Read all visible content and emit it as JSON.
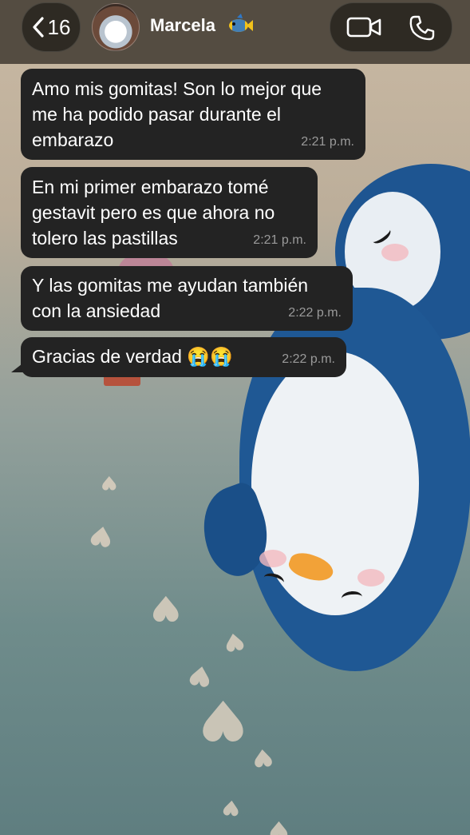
{
  "header": {
    "back_count": "16",
    "contact_name": "Marcela",
    "name_emoji": "fish-icon"
  },
  "messages": [
    {
      "lines": [
        "Amo mis gomitas! Son lo mejor que",
        "me ha podido pasar durante el",
        "embarazo"
      ],
      "time": "2:21 p.m."
    },
    {
      "lines": [
        "En mi primer embarazo tomé",
        "gestavit pero es que ahora no",
        "tolero las pastillas"
      ],
      "time": "2:21 p.m."
    },
    {
      "lines": [
        "Y las gomitas me ayudan también",
        "con la ansiedad"
      ],
      "time": "2:22 p.m."
    },
    {
      "lines": [
        "Gracias de verdad 😭😭"
      ],
      "time": "2:22 p.m."
    }
  ],
  "colors": {
    "bubble": "#232323",
    "time_text": "#9a9a9a",
    "header_bg": "#3a342c"
  }
}
